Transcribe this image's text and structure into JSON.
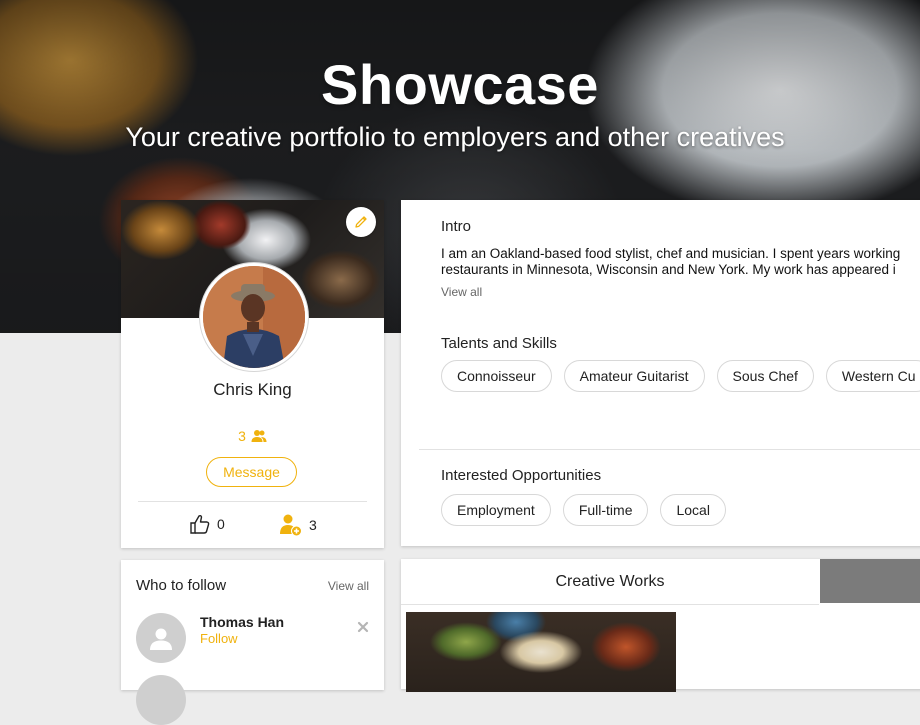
{
  "hero": {
    "title": "Showcase",
    "subtitle": "Your creative portfolio to employers and other creatives"
  },
  "profile": {
    "name": "Chris King",
    "connections_count": "3",
    "message_label": "Message",
    "likes_count": "0",
    "followers_count": "3",
    "icons": [
      "edit-pencil-icon",
      "connections-icon",
      "thumbs-up-icon",
      "add-follower-icon"
    ]
  },
  "intro": {
    "label": "Intro",
    "line1": "I am an Oakland-based food stylist, chef and musician. I spent years working",
    "line2": "restaurants in Minnesota, Wisconsin and New York. My work has appeared i",
    "view_all": "View all"
  },
  "talents": {
    "label": "Talents and Skills",
    "chips": [
      "Connoisseur",
      "Amateur Guitarist",
      "Sous Chef",
      "Western Cu"
    ]
  },
  "opportunities": {
    "label": "Interested Opportunities",
    "chips": [
      "Employment",
      "Full-time",
      "Local"
    ]
  },
  "who_to_follow": {
    "title": "Who to follow",
    "view_all": "View all",
    "people": [
      {
        "name": "Thomas Han",
        "action": "Follow"
      }
    ]
  },
  "works": {
    "tab_label": "Creative Works"
  },
  "colors": {
    "accent": "#f0b20e",
    "inactive_tab": "#7b7b7b",
    "page_bg": "#ececec"
  }
}
